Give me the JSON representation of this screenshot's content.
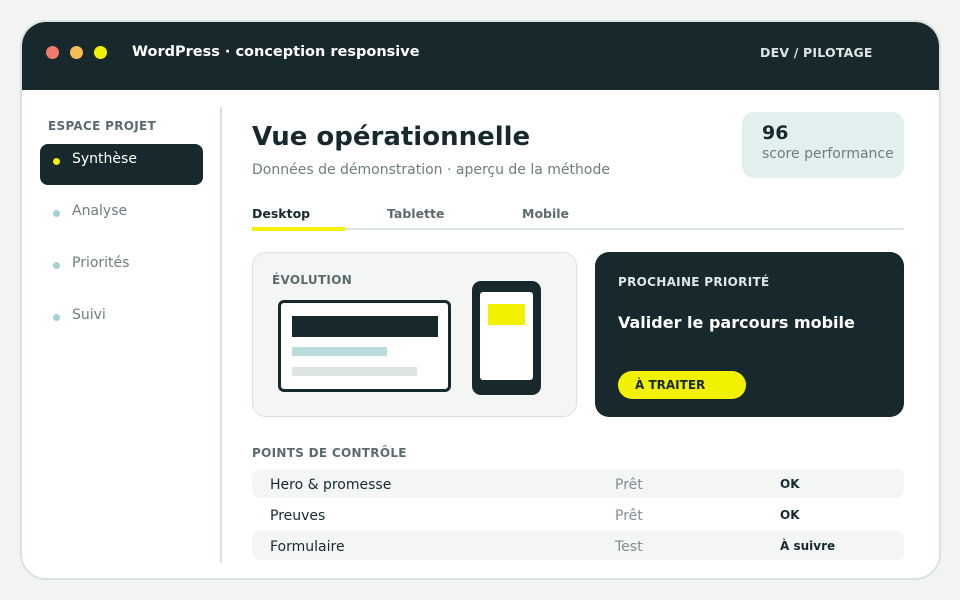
{
  "window": {
    "title": "WordPress · conception responsive",
    "badge": "DEV / PILOTAGE"
  },
  "sidebar": {
    "title": "ESPACE PROJET",
    "items": [
      {
        "label": "Synthèse",
        "active": true
      },
      {
        "label": "Analyse",
        "active": false
      },
      {
        "label": "Priorités",
        "active": false
      },
      {
        "label": "Suivi",
        "active": false
      }
    ]
  },
  "header": {
    "title": "Vue opérationnelle",
    "subtitle": "Données de démonstration · aperçu de la méthode"
  },
  "score": {
    "value": "96",
    "label": "score performance"
  },
  "tabs": [
    {
      "label": "Desktop",
      "active": true
    },
    {
      "label": "Tablette",
      "active": false
    },
    {
      "label": "Mobile",
      "active": false
    }
  ],
  "evolution": {
    "kicker": "ÉVOLUTION"
  },
  "priority": {
    "kicker": "PROCHAINE PRIORITÉ",
    "title": "Valider le parcours mobile",
    "button_label": "À TRAITER"
  },
  "checkpoints": {
    "title": "POINTS DE CONTRÔLE",
    "rows": [
      {
        "name": "Hero & promesse",
        "status": "Prêt",
        "result": "OK"
      },
      {
        "name": "Preuves",
        "status": "Prêt",
        "result": "OK"
      },
      {
        "name": "Formulaire",
        "status": "Test",
        "result": "À suivre"
      }
    ]
  },
  "colors": {
    "primary": "#17292d",
    "accent": "#f2f200",
    "score_bg": "#e1efee",
    "bullet_inactive": "#a9d0d0"
  }
}
